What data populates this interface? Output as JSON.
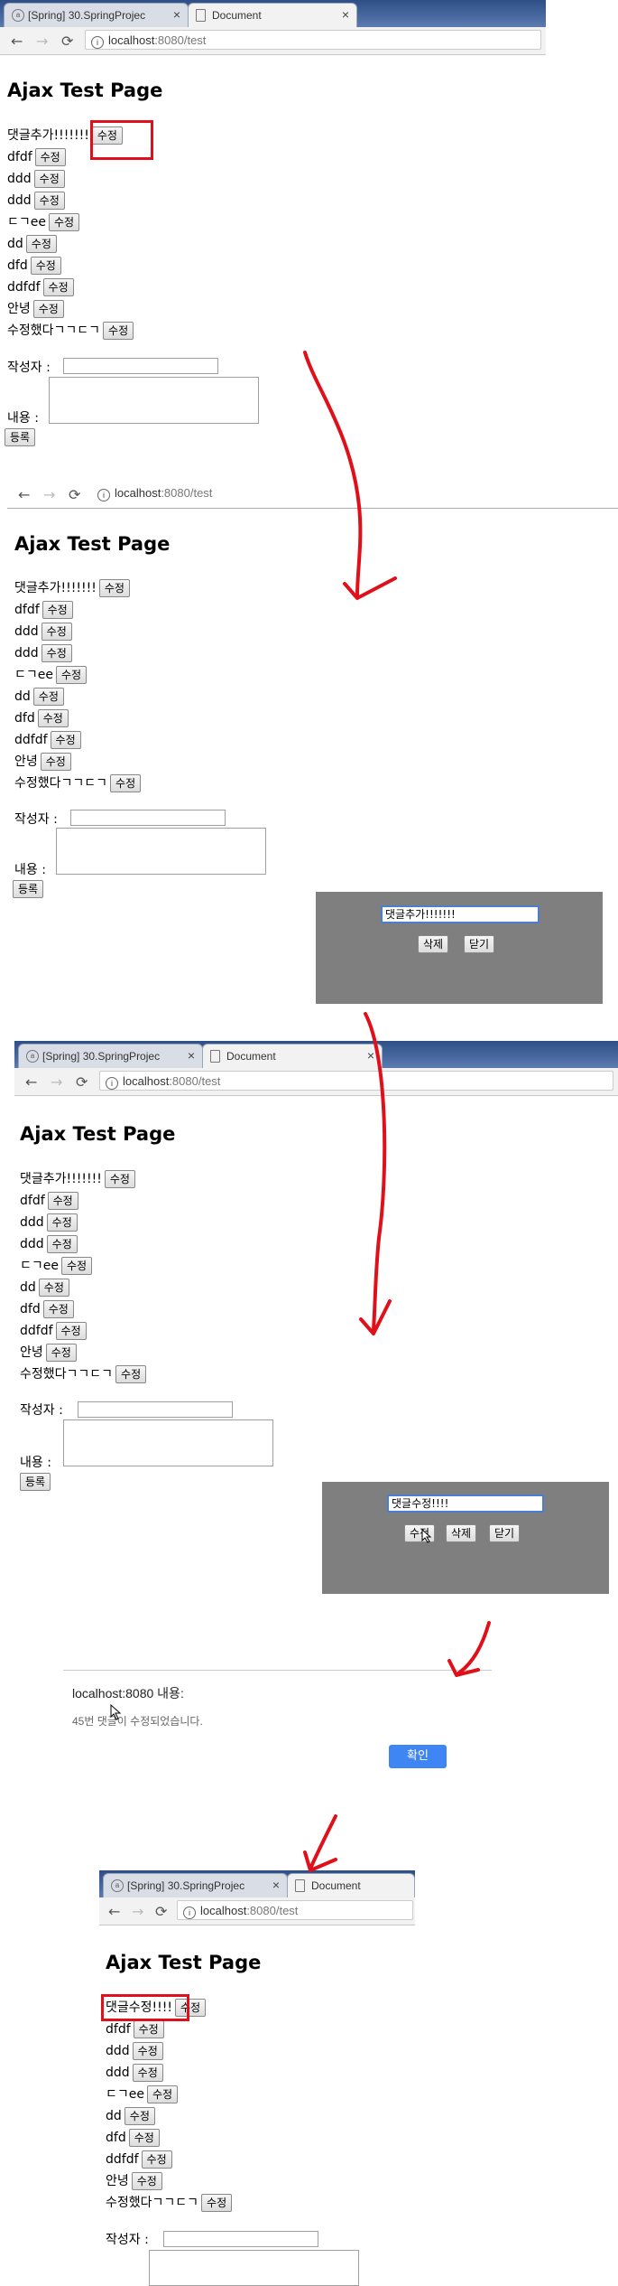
{
  "tabs": {
    "other": "[Spring] 30.SpringProjec",
    "current": "Document"
  },
  "url": {
    "host": "localhost",
    "path": ":8080/test"
  },
  "page_title": "Ajax Test Page",
  "edit_label": "수정",
  "writer_label": "작성자 :",
  "content_label": "내용 :",
  "submit_label": "등록",
  "comments_before": [
    "댓글추가!!!!!!!",
    "dfdf",
    "ddd",
    "ddd",
    "ㄷㄱee",
    "dd",
    "dfd",
    "ddfdf",
    "안녕",
    "수정했다ㄱㄱㄷㄱ"
  ],
  "comments_after": [
    "댓글수정!!!!",
    "dfdf",
    "ddd",
    "ddd",
    "ㄷㄱee",
    "dd",
    "dfd",
    "ddfdf",
    "안녕",
    "수정했다ㄱㄱㄷㄱ"
  ],
  "modal1": {
    "input_value": "댓글추가!!!!!!!",
    "delete_label": "삭제",
    "close_label": "닫기"
  },
  "modal2": {
    "input_value": "댓글수정!!!!",
    "edit_label": "수정",
    "delete_label": "삭제",
    "close_label": "닫기"
  },
  "alert": {
    "title": "localhost:8080 내용:",
    "message": "45번 댓글이 수정되었습니다.",
    "ok_label": "확인"
  },
  "colors": {
    "annotation_red": "#e0101a",
    "modal_bg": "#7f7f7f",
    "ok_blue": "#3f85f4",
    "tab_blue": "#2e4f86"
  }
}
